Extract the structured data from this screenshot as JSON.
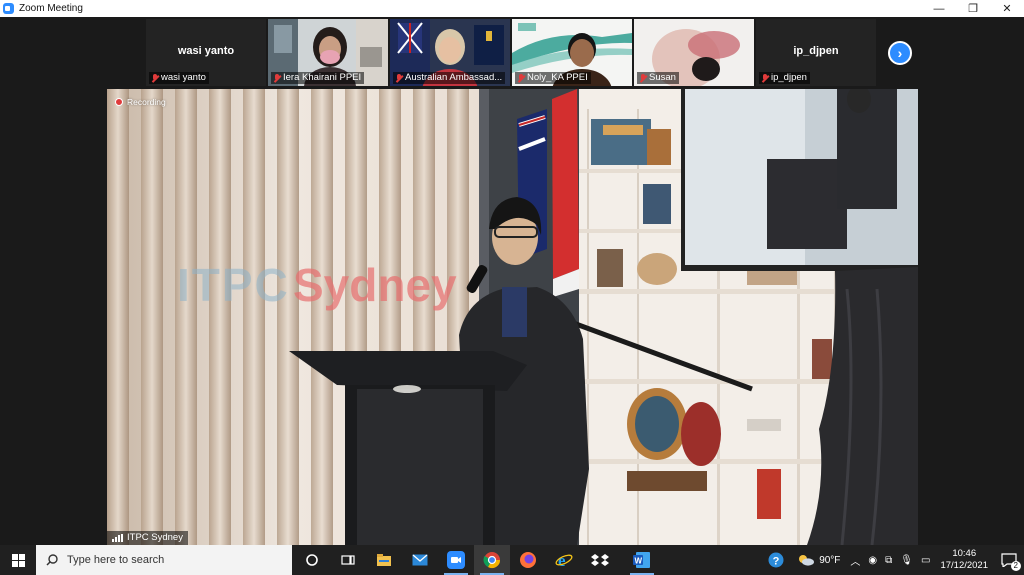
{
  "window": {
    "title": "Zoom Meeting",
    "buttons": {
      "minimize": "—",
      "restore": "❐",
      "close": "✕"
    }
  },
  "participants": [
    {
      "name": "wasi yanto",
      "display_name": "wasi yanto",
      "video": false,
      "muted": true
    },
    {
      "name": "Iera Khairani PPEI",
      "video": true,
      "muted": true
    },
    {
      "name": "Australian Ambassad...",
      "video": true,
      "muted": true
    },
    {
      "name": "Noly_KA PPEI",
      "video": true,
      "muted": true
    },
    {
      "name": "Susan",
      "video": true,
      "muted": true
    },
    {
      "name": "ip_djpen",
      "display_name": "ip_djpen",
      "video": false,
      "muted": true
    }
  ],
  "strip_next_icon": "chevron-right-icon",
  "main_video": {
    "recording_label": "Recording",
    "speaker_name": "ITPC Sydney",
    "wall_sign": "ITPC Sydney"
  },
  "taskbar": {
    "search_placeholder": "Type here to search",
    "apps": [
      "cortana-icon",
      "task-view-icon",
      "file-explorer-icon",
      "mail-icon",
      "zoom-icon",
      "chrome-icon",
      "firefox-icon",
      "internet-explorer-icon",
      "dropbox-icon",
      "word-icon"
    ],
    "weather": "90°F",
    "time": "10:46",
    "date": "17/12/2021",
    "notifications": "2"
  },
  "colors": {
    "zoom_blue": "#2d8cff",
    "muted_red": "#e03b3b",
    "taskbar_bg": "#202020",
    "meeting_bg": "#1a1a1a"
  }
}
